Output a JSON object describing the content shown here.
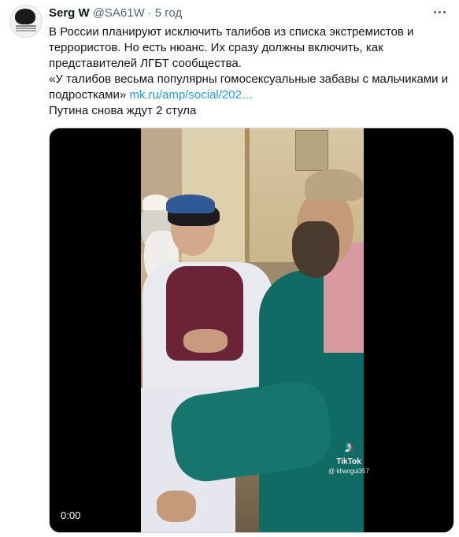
{
  "tweet": {
    "avatar_icon": "user-avatar",
    "author_name": "Serg W",
    "author_handle": "@SA61W",
    "separator": "·",
    "timestamp": "5 год",
    "more_icon": "ellipsis-icon",
    "text_lines": [
      "В России планируют исключить талибов из списка экстремистов и",
      "террористов. Но есть нюанс. Их сразу должны включить, как",
      "представителей ЛГБТ сообщества."
    ],
    "quote_start": "«У талибов весьма популярны гомосексуальные забавы с мальчиками и",
    "quote_end": "подростками» ",
    "link_text": "mk.ru/amp/social/202…",
    "last_line": "Путина снова ждут 2 стула"
  },
  "media": {
    "watermark_brand": "TikTok",
    "watermark_user": "@ khangul357",
    "watermark_icon": "tiktok-note-icon",
    "time_display": "0:00"
  },
  "colors": {
    "link": "#1d9bf0",
    "secondary_text": "#536471",
    "text": "#0f1419"
  }
}
